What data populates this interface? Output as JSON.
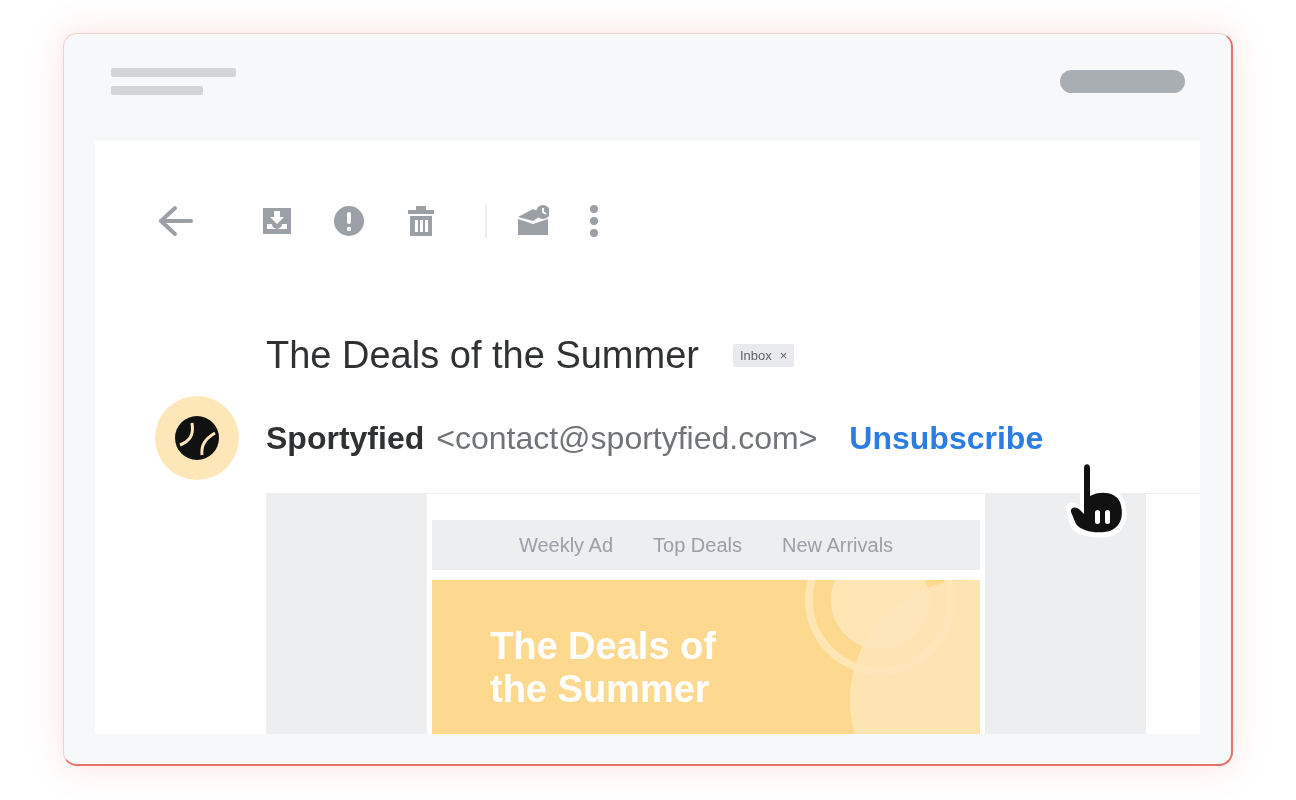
{
  "subject": "The Deals of the Summer",
  "label_chip": {
    "text": "Inbox",
    "remove": "×"
  },
  "sender": {
    "name": "Sportyfied",
    "email": "<contact@sportyfied.com>"
  },
  "unsubscribe": "Unsubscribe",
  "email_body": {
    "nav": [
      "Weekly Ad",
      "Top Deals",
      "New Arrivals"
    ],
    "banner_title": [
      "The Deals of",
      "the Summer"
    ]
  }
}
